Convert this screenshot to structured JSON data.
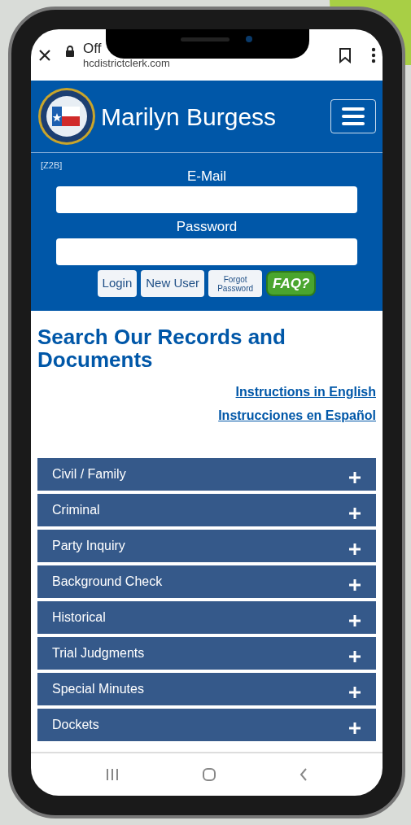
{
  "browser_bar": {
    "title": "Off",
    "url": "hcdistrictclerk.com"
  },
  "header": {
    "title": "Marilyn Burgess"
  },
  "login": {
    "code": "[Z2B]",
    "email_label": "E-Mail",
    "password_label": "Password",
    "buttons": [
      {
        "kind": "text",
        "label": "Login"
      },
      {
        "kind": "text",
        "label": "New User"
      },
      {
        "kind": "small",
        "label": "Forgot Password"
      },
      {
        "kind": "faq",
        "label": "FAQ?"
      }
    ]
  },
  "search": {
    "heading": "Search Our Records and Documents",
    "links": [
      "Instructions in English",
      "Instrucciones en Español"
    ]
  },
  "sections": [
    {
      "label": "Civil / Family",
      "expanded": false
    },
    {
      "label": "Criminal",
      "expanded": false
    },
    {
      "label": "Party Inquiry",
      "expanded": false
    },
    {
      "label": "Background Check",
      "expanded": false
    },
    {
      "label": "Historical",
      "expanded": false
    },
    {
      "label": "Trial Judgments",
      "expanded": false
    },
    {
      "label": "Special Minutes",
      "expanded": false
    },
    {
      "label": "Dockets",
      "expanded": false
    }
  ]
}
